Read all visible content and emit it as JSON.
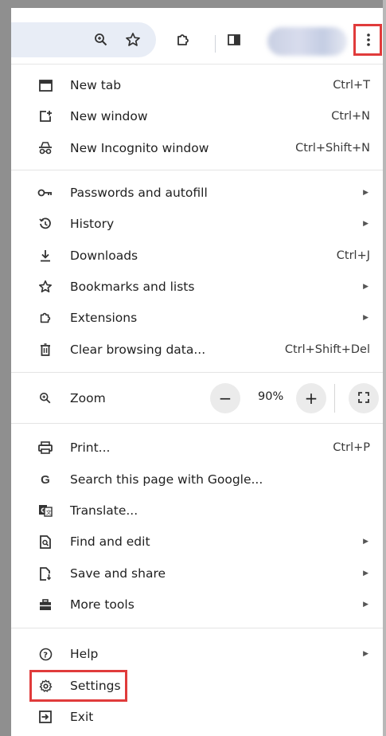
{
  "toolbar": {
    "icons": [
      "zoom-magnifier-icon",
      "bookmark-star-icon",
      "extensions-puzzle-icon",
      "side-panel-icon",
      "more-vertical-icon"
    ]
  },
  "menu": {
    "new_tab": {
      "label": "New tab",
      "shortcut": "Ctrl+T"
    },
    "new_window": {
      "label": "New window",
      "shortcut": "Ctrl+N"
    },
    "new_incognito": {
      "label": "New Incognito window",
      "shortcut": "Ctrl+Shift+N"
    },
    "passwords": {
      "label": "Passwords and autofill"
    },
    "history": {
      "label": "History"
    },
    "downloads": {
      "label": "Downloads",
      "shortcut": "Ctrl+J"
    },
    "bookmarks": {
      "label": "Bookmarks and lists"
    },
    "extensions": {
      "label": "Extensions"
    },
    "clear_data": {
      "label": "Clear browsing data...",
      "shortcut": "Ctrl+Shift+Del"
    },
    "zoom": {
      "label": "Zoom",
      "minus": "−",
      "value": "90%",
      "plus": "+"
    },
    "print": {
      "label": "Print...",
      "shortcut": "Ctrl+P"
    },
    "search_google": {
      "label": "Search this page with Google..."
    },
    "translate": {
      "label": "Translate..."
    },
    "find_edit": {
      "label": "Find and edit"
    },
    "save_share": {
      "label": "Save and share"
    },
    "more_tools": {
      "label": "More tools"
    },
    "help": {
      "label": "Help"
    },
    "settings": {
      "label": "Settings"
    },
    "exit": {
      "label": "Exit"
    }
  },
  "colors": {
    "highlight": "#e03b3b",
    "omnibox_bg": "#e8edf6",
    "zoom_button_bg": "#ebebeb"
  }
}
